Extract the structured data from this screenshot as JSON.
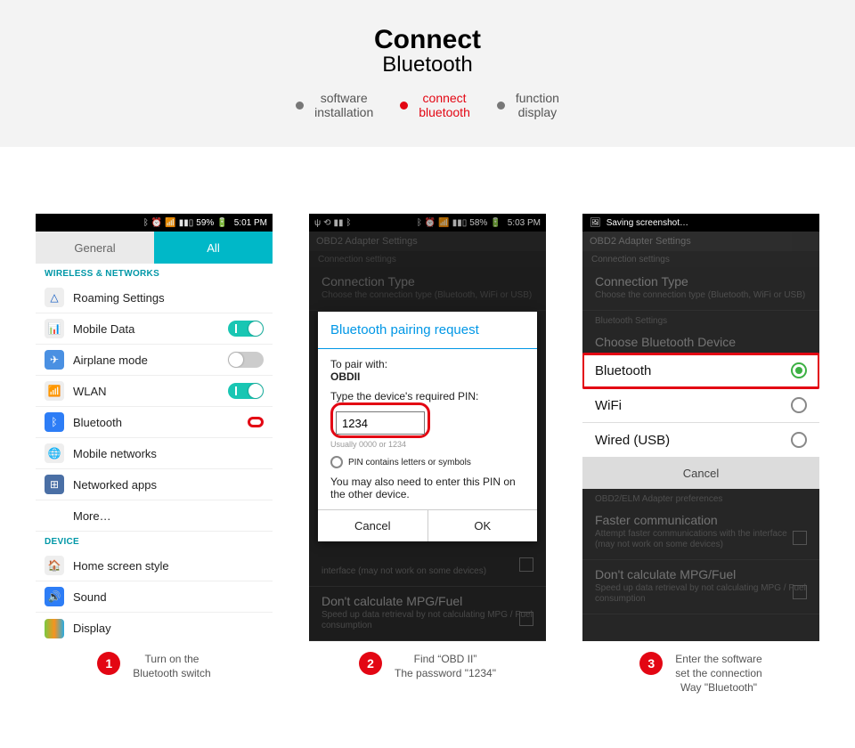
{
  "banner": {
    "title1": "Connect",
    "title2": "Bluetooth"
  },
  "crumbs": {
    "a": {
      "l1": "software",
      "l2": "installation"
    },
    "b": {
      "l1": "connect",
      "l2": "bluetooth"
    },
    "c": {
      "l1": "function",
      "l2": "display"
    }
  },
  "ph1": {
    "status": {
      "batt": "59%",
      "time": "5:01 PM"
    },
    "tabs": {
      "general": "General",
      "all": "All"
    },
    "sect1": "WIRELESS & NETWORKS",
    "items": {
      "roaming": "Roaming Settings",
      "mobile": "Mobile Data",
      "airplane": "Airplane mode",
      "wlan": "WLAN",
      "bluetooth": "Bluetooth",
      "mobnet": "Mobile networks",
      "netapps": "Networked apps",
      "more": "More…"
    },
    "sect2": "DEVICE",
    "items2": {
      "home": "Home screen style",
      "sound": "Sound",
      "display": "Display"
    }
  },
  "ph2": {
    "status": {
      "batt": "58%",
      "time": "5:03 PM"
    },
    "appTitle": "OBD2 Adapter Settings",
    "subTitle": "Connection settings",
    "connType": {
      "t": "Connection Type",
      "s": "Choose the connection type (Bluetooth, WiFi or USB)"
    },
    "dialog": {
      "title": "Bluetooth pairing request",
      "pairLabel": "To pair with:",
      "pairDevice": "OBDII",
      "pinLabel": "Type the device's required PIN:",
      "pinValue": "1234",
      "pinHint": "Usually 0000 or 1234",
      "pinCheck": "PIN contains letters or symbols",
      "note": "You may also need to enter this PIN on the other device.",
      "cancel": "Cancel",
      "ok": "OK"
    },
    "below": {
      "ifaceS": "interface (may not work on some devices)",
      "mpgT": "Don't calculate MPG/Fuel",
      "mpgS": "Speed up data retrieval by not calculating MPG / Fuel consumption"
    }
  },
  "ph3": {
    "statusText": "Saving screenshot…",
    "appTitle": "OBD2 Adapter Settings",
    "subTitle": "Connection settings",
    "connType": {
      "t": "Connection Type",
      "s": "Choose the connection type (Bluetooth, WiFi or USB)"
    },
    "btCat": "Bluetooth Settings",
    "chooseTitle": "Choose Bluetooth Device",
    "choose": {
      "bt": "Bluetooth",
      "wifi": "WiFi",
      "usb": "Wired (USB)",
      "cancel": "Cancel"
    },
    "below": {
      "obdPrefs": "OBD2/ELM Adapter preferences",
      "fastT": "Faster communication",
      "fastS": "Attempt faster communications with the interface (may not work on some devices)",
      "mpgT": "Don't calculate MPG/Fuel",
      "mpgS": "Speed up data retrieval by not calculating MPG / Fuel consumption"
    }
  },
  "captions": {
    "c1": {
      "n": "1",
      "l1": "Turn on the",
      "l2": "Bluetooth switch"
    },
    "c2": {
      "n": "2",
      "l1": "Find  “OBD II”",
      "l2": "The password \"1234\""
    },
    "c3": {
      "n": "3",
      "l1": "Enter the software",
      "l2": "set the connection",
      "l3": "Way \"Bluetooth\""
    }
  }
}
